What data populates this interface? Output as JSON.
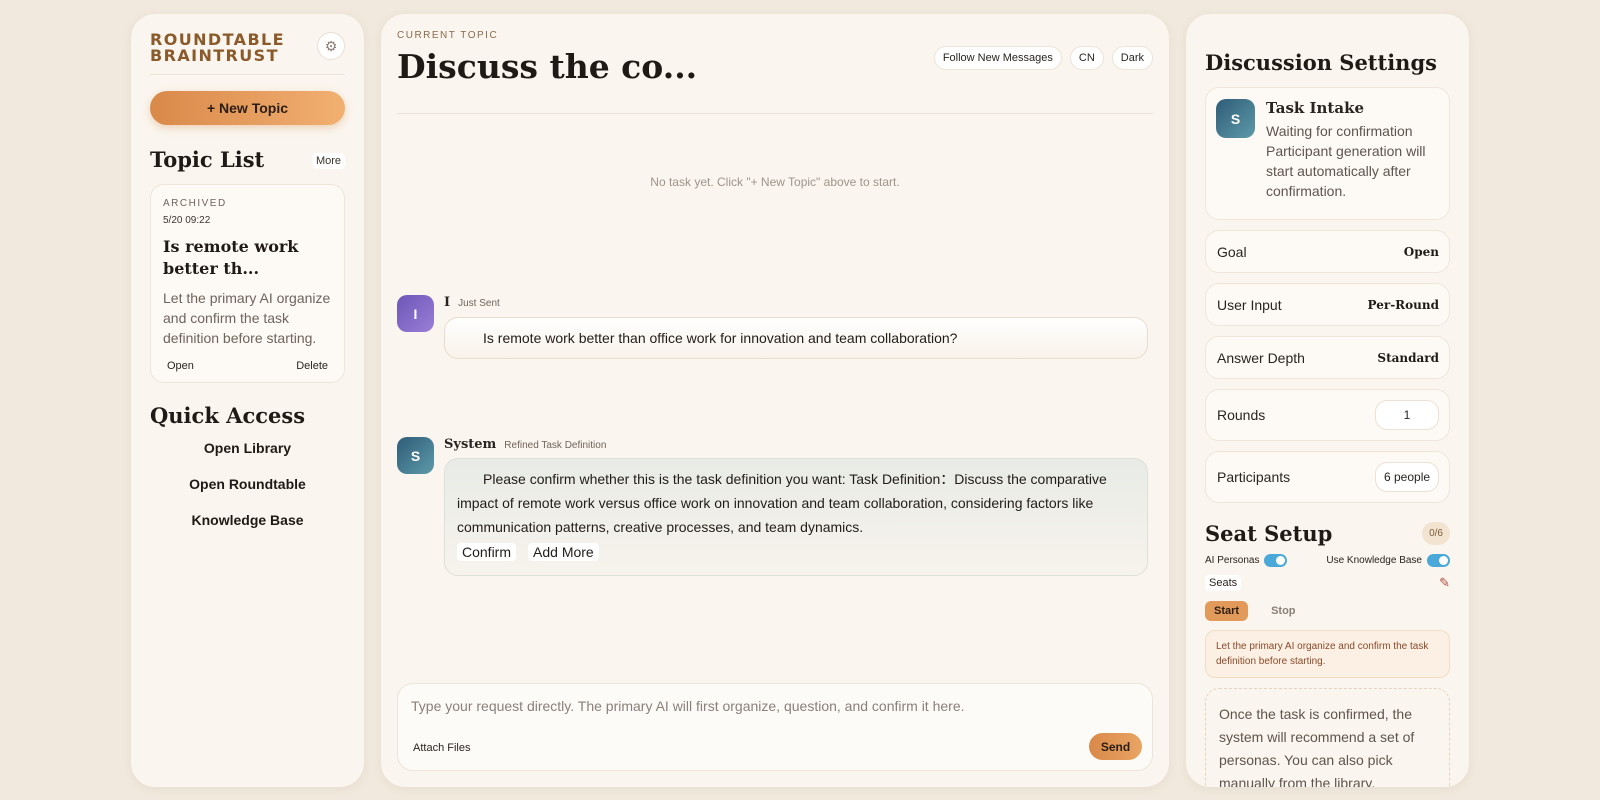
{
  "sidebar": {
    "brand_line1": "ROUNDTABLE",
    "brand_line2": "BRAINTRUST",
    "settings_icon": "gear-icon",
    "new_topic_label": "+ New Topic",
    "topic_list_title": "Topic List",
    "more_label": "More",
    "topic": {
      "status": "ARCHIVED",
      "date": "5/20 09:22",
      "title": "Is remote work better th...",
      "description": "Let the primary AI organize and confirm the task definition before starting.",
      "open_label": "Open",
      "delete_label": "Delete"
    },
    "quick_access_title": "Quick Access",
    "quick_access_items": [
      "Open Library",
      "Open Roundtable",
      "Knowledge Base"
    ]
  },
  "main": {
    "current_topic_label": "CURRENT TOPIC",
    "title": "Discuss the co...",
    "follow_label": "Follow New Messages",
    "lang_label": "CN",
    "theme_label": "Dark",
    "empty_note": "No task yet. Click \"+ New Topic\" above to start.",
    "messages": [
      {
        "avatar": "I",
        "author": "I",
        "tag": "Just Sent",
        "text": "Is remote work better than office work for innovation and team collaboration?"
      },
      {
        "avatar": "S",
        "author": "System",
        "tag": "Refined Task Definition",
        "text": "Please confirm whether this is the task definition you want: Task Definition：Discuss the comparative impact of remote work versus office work on innovation and team collaboration, considering factors like communication patterns, creative processes, and team dynamics.",
        "confirm_label": "Confirm",
        "add_more_label": "Add More"
      }
    ],
    "composer": {
      "placeholder": "Type your request directly. The primary AI will first organize, question, and confirm it here.",
      "attach_label": "Attach Files",
      "send_label": "Send"
    }
  },
  "settings": {
    "title": "Discussion Settings",
    "intake": {
      "avatar": "S",
      "title": "Task Intake",
      "text": "Waiting for confirmation Participant generation will start automatically after confirmation."
    },
    "goal": {
      "label": "Goal",
      "value": "Open"
    },
    "user_input": {
      "label": "User Input",
      "value": "Per-Round"
    },
    "answer_depth": {
      "label": "Answer Depth",
      "value": "Standard"
    },
    "rounds": {
      "label": "Rounds",
      "value": "1"
    },
    "participants": {
      "label": "Participants",
      "value": "6 people"
    },
    "seat_setup": {
      "title": "Seat Setup",
      "count": "0/6",
      "ai_personas_label": "AI Personas",
      "ai_personas_on": true,
      "knowledge_base_label": "Use Knowledge Base",
      "knowledge_base_on": true,
      "seats_label": "Seats",
      "edit_icon": "feather-icon",
      "start_label": "Start",
      "stop_label": "Stop",
      "hint": "Let the primary AI organize and confirm the task definition before starting.",
      "placeholder": "Once the task is confirmed, the system will recommend a set of personas. You can also pick manually from the library."
    }
  },
  "colors": {
    "accent": "#e29a5a",
    "brand": "#8a5a2b",
    "toggle_on": "#4aa9d8"
  }
}
